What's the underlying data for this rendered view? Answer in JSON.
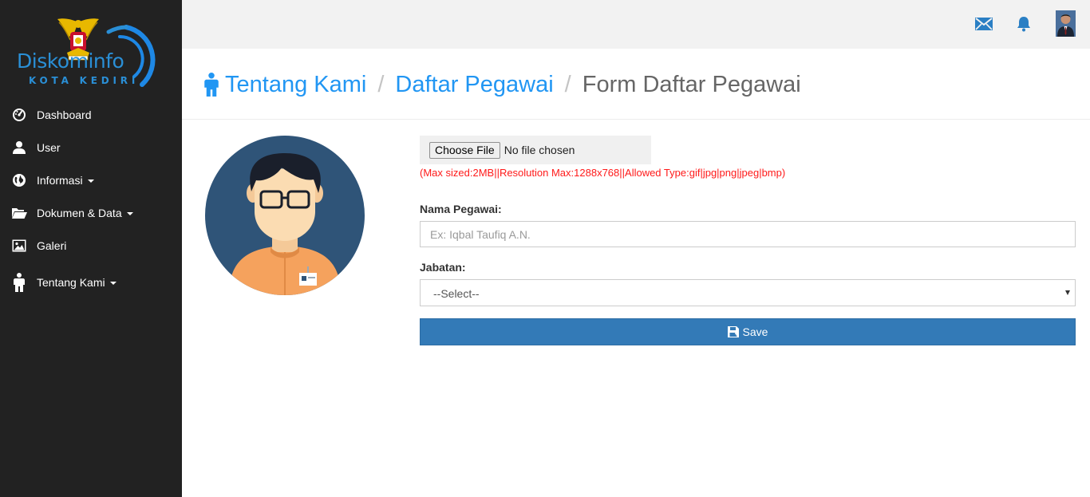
{
  "brand": {
    "name": "Diskominfo",
    "subtitle": "KOTA KEDIRI",
    "accent_color": "#2a8fd6"
  },
  "sidebar": {
    "items": [
      {
        "label": "Dashboard",
        "icon": "dashboard-gauge-icon",
        "has_caret": false
      },
      {
        "label": "User",
        "icon": "user-icon",
        "has_caret": false
      },
      {
        "label": "Informasi",
        "icon": "globe-icon",
        "has_caret": true
      },
      {
        "label": "Dokumen & Data",
        "icon": "folder-open-icon",
        "has_caret": true
      },
      {
        "label": "Galeri",
        "icon": "picture-icon",
        "has_caret": false
      },
      {
        "label": "Tentang Kami",
        "icon": "person-icon",
        "has_caret": true
      }
    ]
  },
  "topbar": {
    "icons": [
      "envelope-icon",
      "bell-icon",
      "user-avatar"
    ]
  },
  "breadcrumb": {
    "icon": "person-icon",
    "items": [
      "Tentang Kami",
      "Daftar Pegawai"
    ],
    "current": "Form Daftar Pegawai",
    "separator": "/",
    "link_color": "#2196f3"
  },
  "form": {
    "file_button": "Choose File",
    "file_status": "No file chosen",
    "file_hint": "(Max sized:2MB||Resolution Max:1288x768||Allowed Type:gif|jpg|png|jpeg|bmp)",
    "nama_label": "Nama Pegawai:",
    "nama_placeholder": "Ex: Iqbal Taufiq A.N.",
    "nama_value": "",
    "jabatan_label": "Jabatan:",
    "jabatan_selected": "--Select--",
    "save_label": "Save",
    "save_color": "#337ab7"
  }
}
